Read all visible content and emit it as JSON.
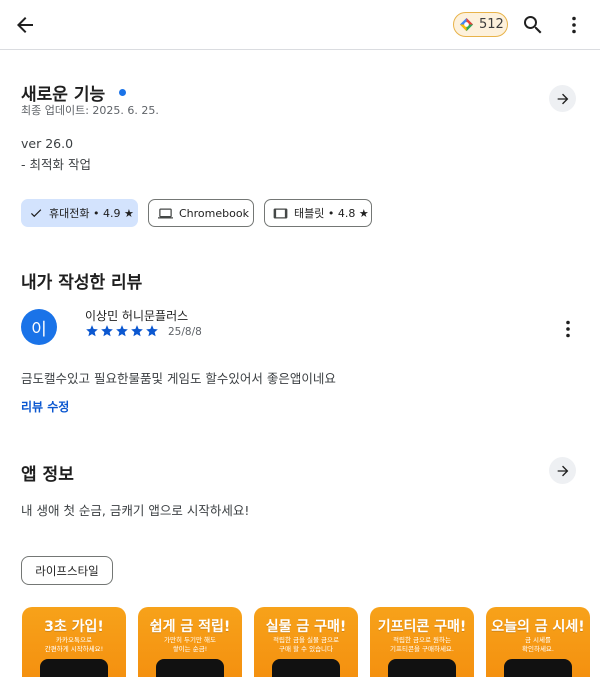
{
  "header": {
    "points": "512"
  },
  "whats_new": {
    "title": "새로운 기능",
    "updated": "최종 업데이트: 2025. 6. 25.",
    "version": "ver 26.0",
    "note": "- 최적화 작업"
  },
  "devices": [
    {
      "label": "휴대전화 • 4.9 ★",
      "selected": true
    },
    {
      "label": "Chromebook",
      "selected": false
    },
    {
      "label": "태블릿 • 4.8 ★",
      "selected": false
    }
  ],
  "my_review": {
    "title": "내가 작성한 리뷰",
    "avatar_letter": "이",
    "reviewer": "이상민 허니문플러스",
    "rating": 5,
    "date": "25/8/8",
    "text": "금도캘수있고 필요한물품및 게임도 할수있어서 좋은앱이네요",
    "edit_link": "리뷰 수정"
  },
  "app_info": {
    "title": "앱 정보",
    "description": "내 생애 첫 순금, 금캐기 앱으로 시작하세요!",
    "category": "라이프스타일"
  },
  "screenshots": [
    {
      "title": "3초 가입!",
      "sub1": "카카오톡으로",
      "sub2": "간편하게 시작하세요!"
    },
    {
      "title": "쉽게 금 적립!",
      "sub1": "가만히 두기만 해도",
      "sub2": "쌓이는 순금!"
    },
    {
      "title": "실물 금 구매!",
      "sub1": "적립한 금을 실물 금으로",
      "sub2": "구매 할 수 있습니다"
    },
    {
      "title": "기프티콘 구매!",
      "sub1": "적립한 금으로 원하는",
      "sub2": "기프티콘을 구매하세요."
    },
    {
      "title": "오늘의 금 시세!",
      "sub1": "금 시세를",
      "sub2": "확인하세요."
    }
  ],
  "colors": {
    "accent_blue": "#0b57d0",
    "selected_chip": "#d3e3fd",
    "new_dot": "#1a73e8",
    "screenshot_orange": "#f7a21a"
  }
}
